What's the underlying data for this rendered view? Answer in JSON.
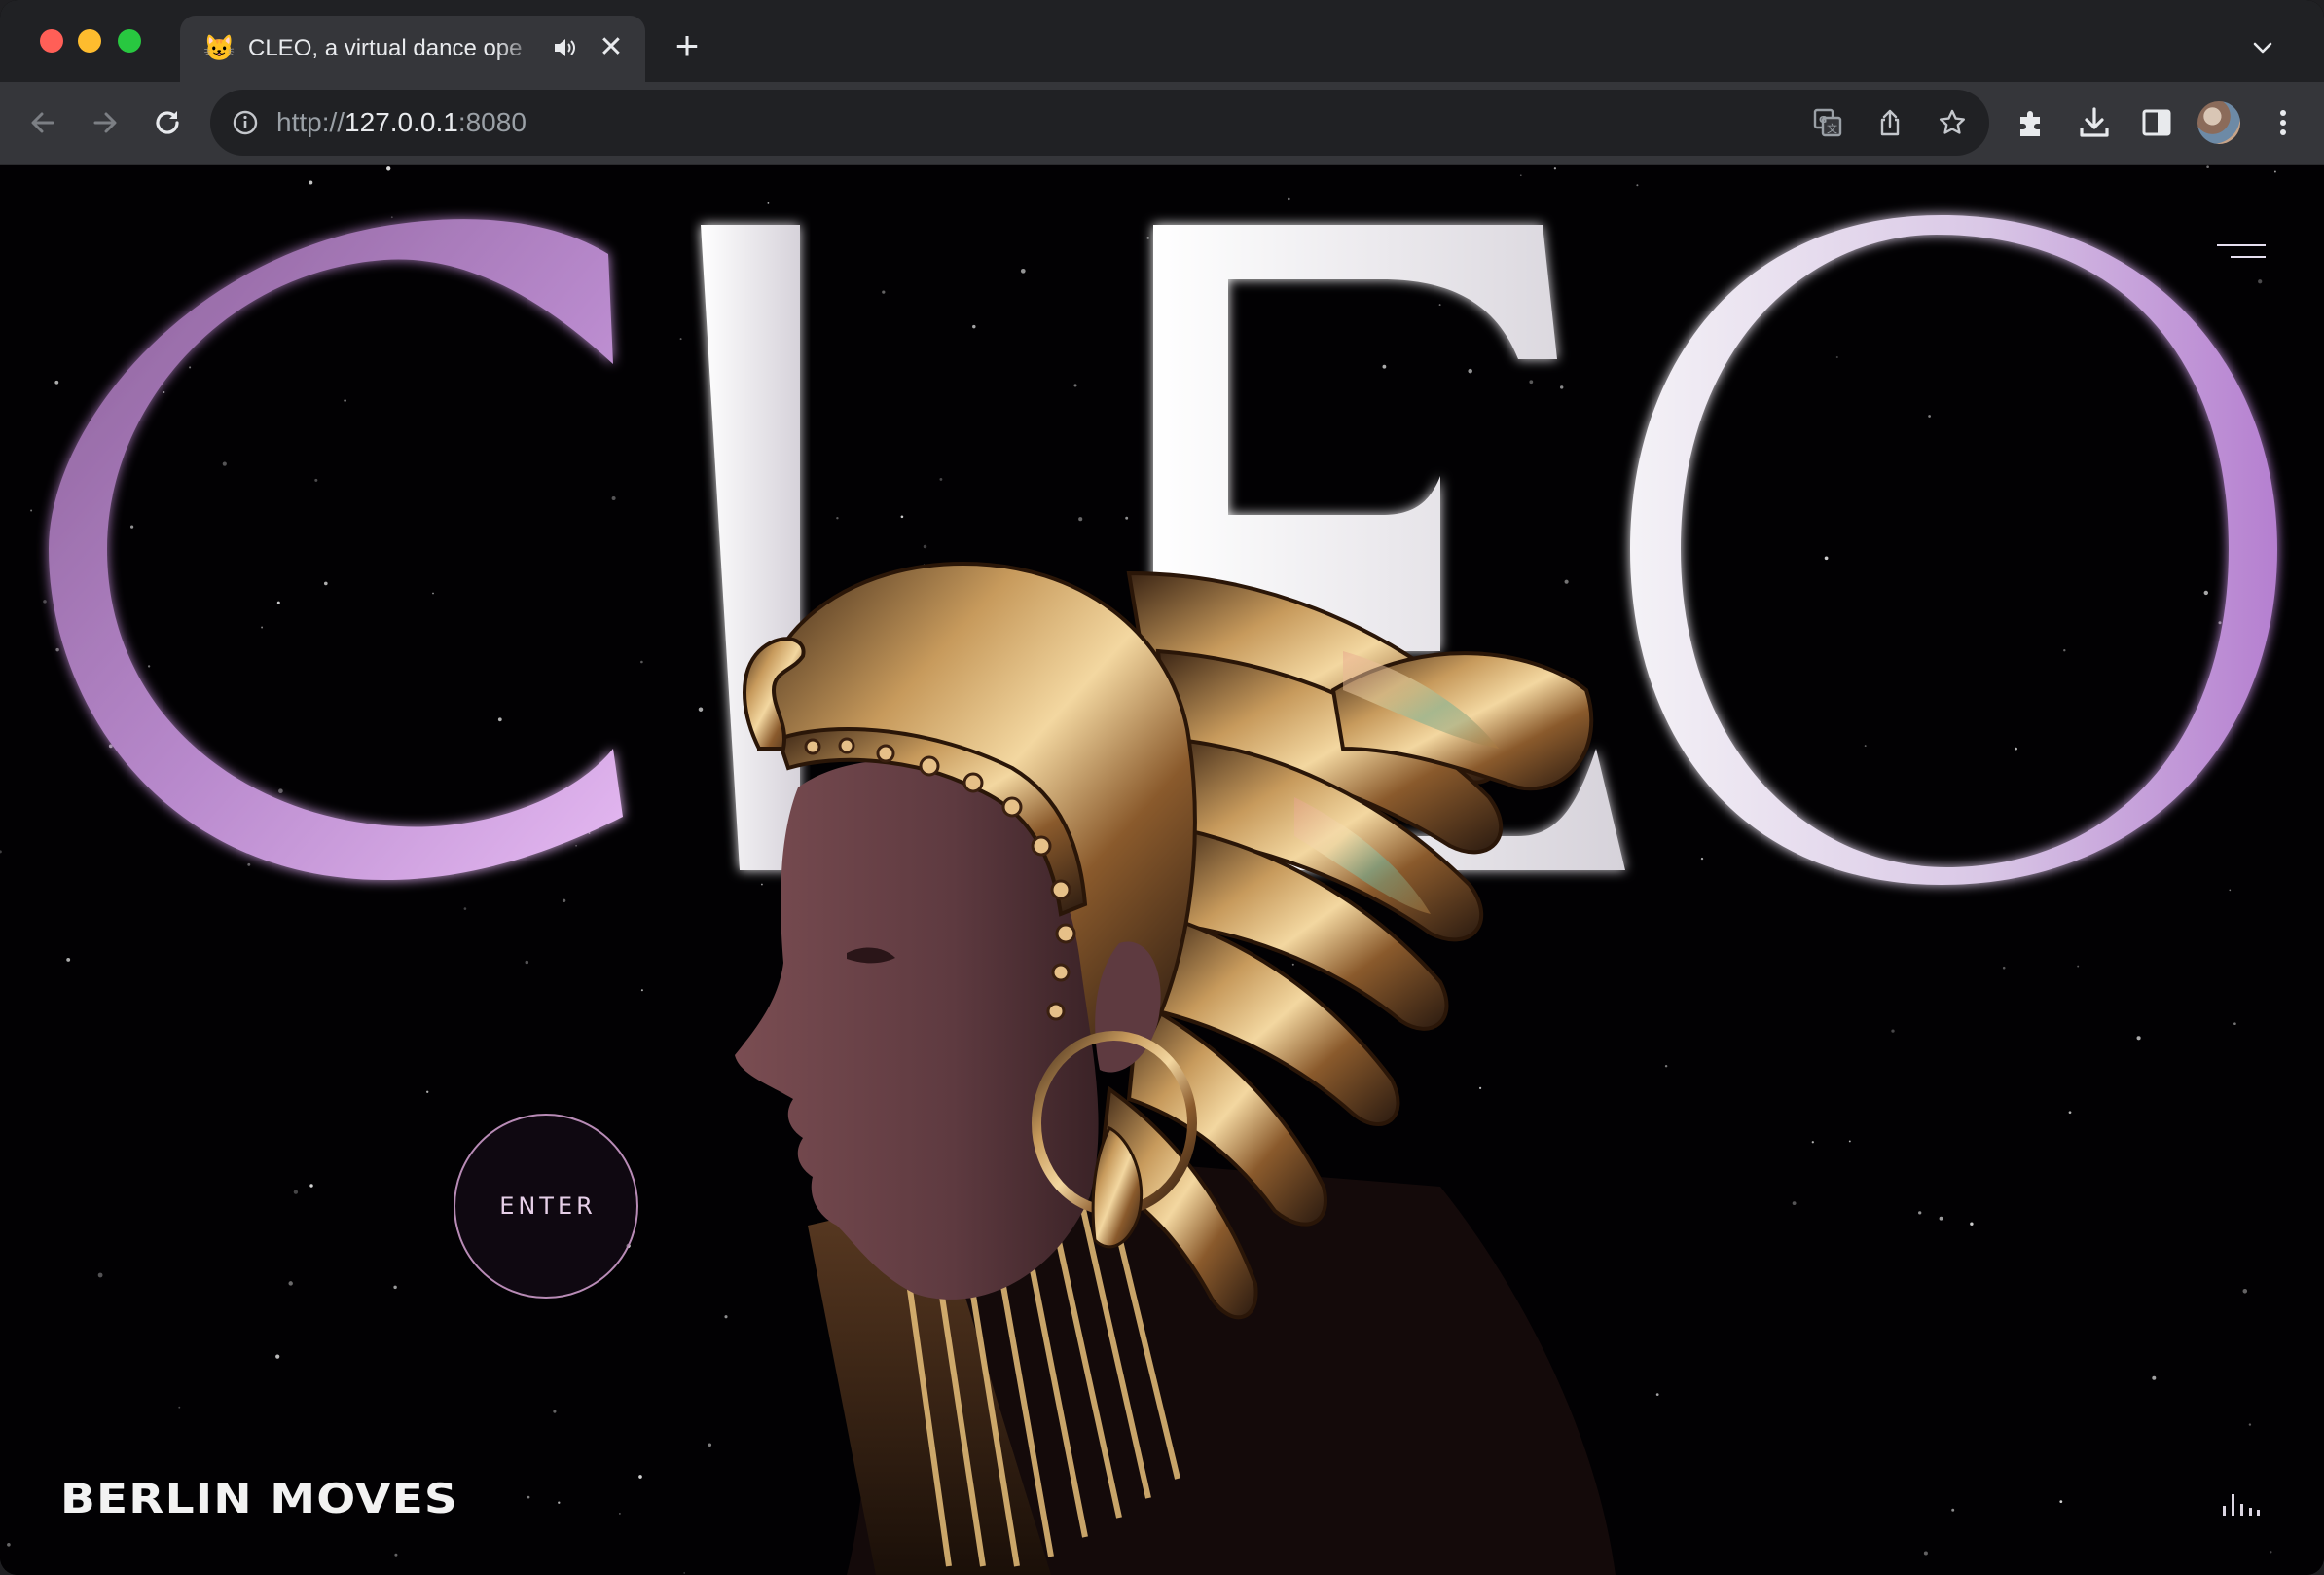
{
  "browser": {
    "tab": {
      "title": "CLEO, a virtual dance ope",
      "favicon": "cat-emoji-icon",
      "favicon_glyph": "😺",
      "audio_icon": "speaker-icon",
      "close_glyph": "✕"
    },
    "new_tab_glyph": "+",
    "address": {
      "scheme": "http://",
      "host": "127.0.0.1",
      "port": ":8080"
    }
  },
  "page": {
    "title_letters": [
      "C",
      "L",
      "E",
      "O"
    ],
    "enter_label": "ENTER",
    "brand": "BERLIN MOVES",
    "colors": {
      "background": "#020103",
      "accent": "#b88bb6",
      "letter_light": "#f2eef5",
      "letter_violet": "#c28fd8"
    }
  }
}
